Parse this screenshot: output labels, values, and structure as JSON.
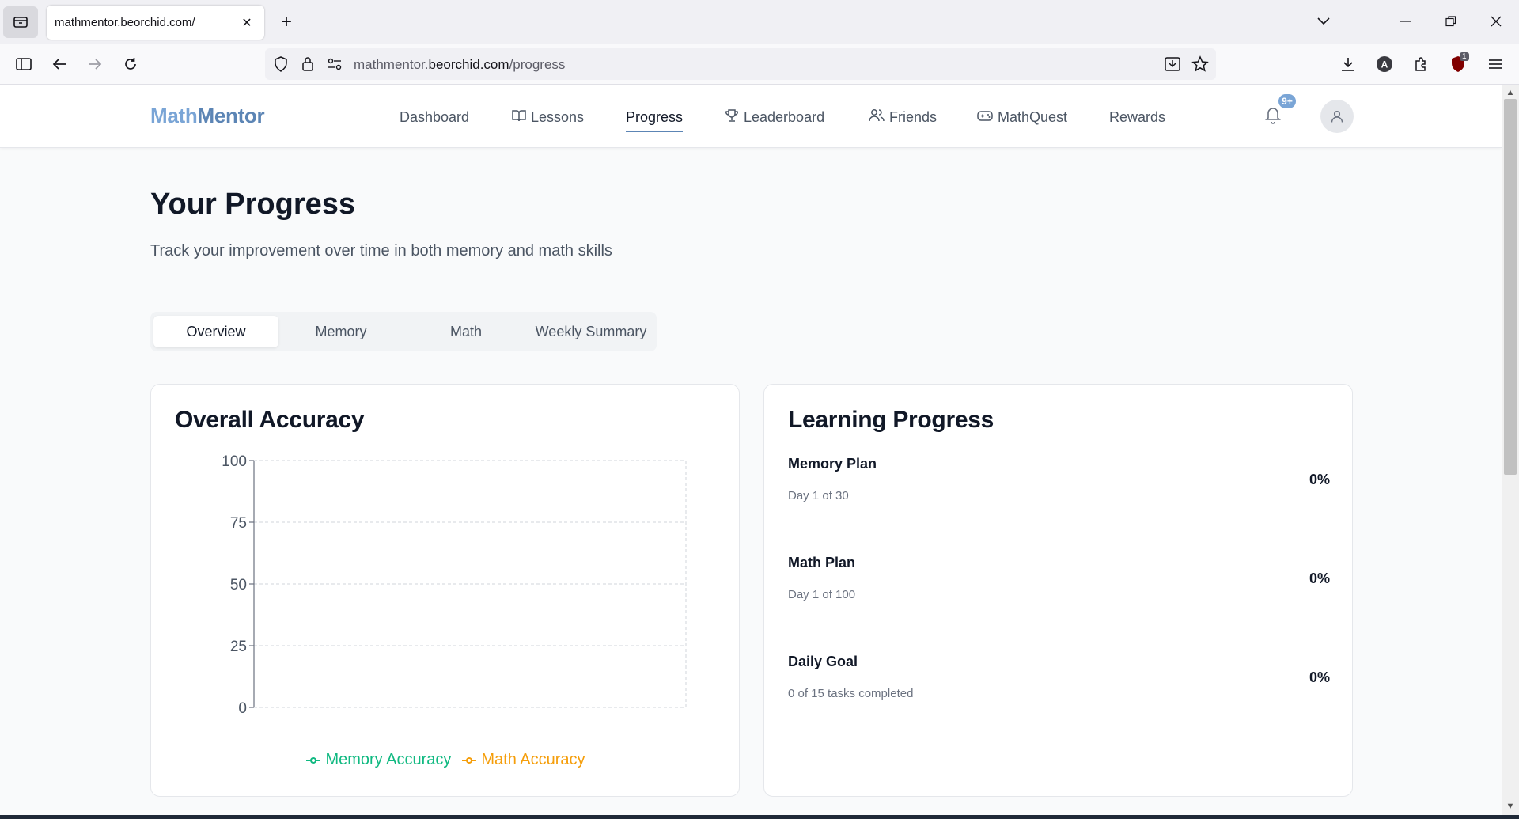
{
  "browser": {
    "tab_title": "mathmentor.beorchid.com/",
    "url_host_prefix": "mathmentor.",
    "url_host": "beorchid.com",
    "url_path": "/progress",
    "extension_badge": "1"
  },
  "header": {
    "logo_part1": "Math",
    "logo_part2": "Mentor",
    "menu": [
      {
        "label": "Dashboard"
      },
      {
        "label": "Lessons"
      },
      {
        "label": "Progress"
      },
      {
        "label": "Leaderboard"
      },
      {
        "label": "Friends"
      },
      {
        "label": "MathQuest"
      },
      {
        "label": "Rewards"
      }
    ],
    "notification_badge": "9+"
  },
  "page": {
    "title": "Your Progress",
    "subtitle": "Track your improvement over time in both memory and math skills",
    "tabs": [
      {
        "label": "Overview",
        "active": true
      },
      {
        "label": "Memory",
        "active": false
      },
      {
        "label": "Math",
        "active": false
      },
      {
        "label": "Weekly Summary",
        "active": false
      }
    ]
  },
  "accuracy_card": {
    "title": "Overall Accuracy"
  },
  "chart_data": {
    "type": "line",
    "title": "Overall Accuracy",
    "x": [],
    "series": [
      {
        "name": "Memory Accuracy",
        "values": [],
        "color": "#10b981"
      },
      {
        "name": "Math Accuracy",
        "values": [],
        "color": "#f59e0b"
      }
    ],
    "yticks": [
      "100",
      "75",
      "50",
      "25",
      "0"
    ],
    "ylim": [
      0,
      100
    ],
    "grid": true,
    "legend": "bottom"
  },
  "learning_card": {
    "title": "Learning Progress",
    "items": [
      {
        "name": "Memory Plan",
        "sub": "Day 1 of 30",
        "pct": "0%"
      },
      {
        "name": "Math Plan",
        "sub": "Day 1 of 100",
        "pct": "0%"
      },
      {
        "name": "Daily Goal",
        "sub": "0 of 15 tasks completed",
        "pct": "0%"
      }
    ]
  }
}
